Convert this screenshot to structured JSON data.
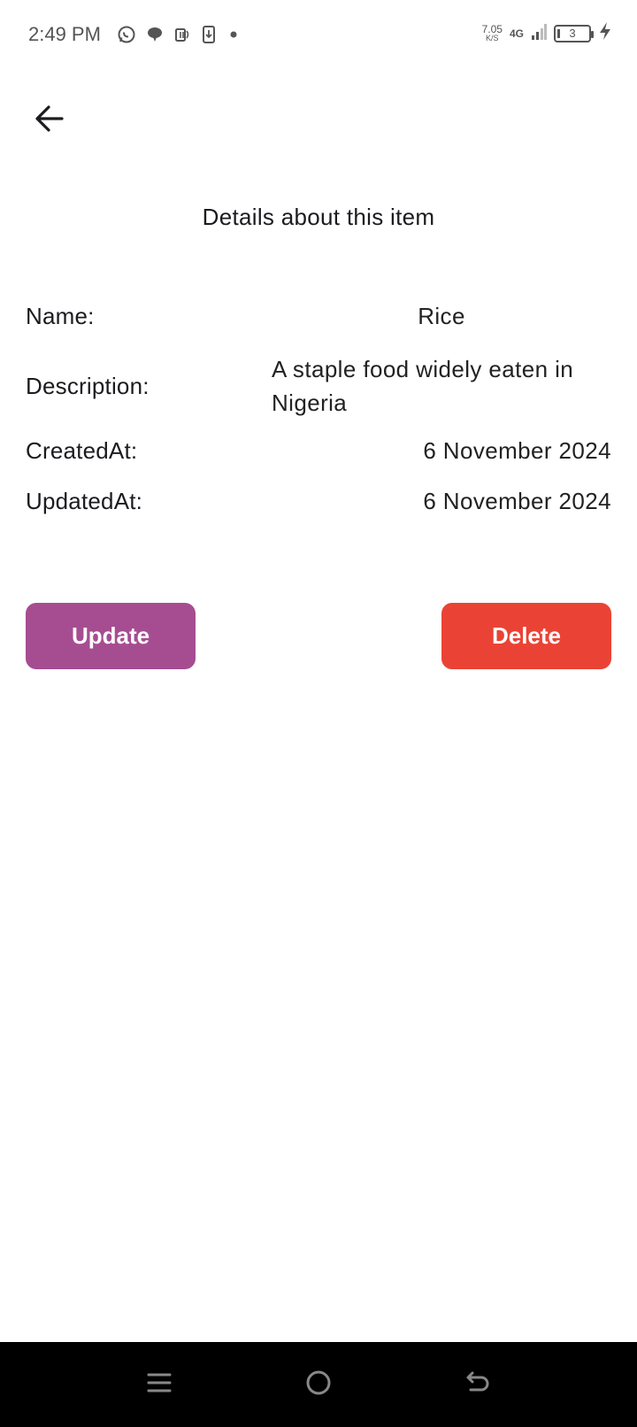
{
  "status_bar": {
    "time": "2:49 PM",
    "net_speed_value": "7.05",
    "net_speed_unit": "K/S",
    "network_type": "4G",
    "battery_level": "3",
    "notification_icons": [
      "whatsapp-icon",
      "chat-icon",
      "nfc-icon",
      "download-icon",
      "dot-icon"
    ]
  },
  "header": {
    "back_icon": "arrow-left-icon",
    "title": "Details about this item"
  },
  "details": {
    "name_label": "Name:",
    "name_value": "Rice",
    "description_label": "Description:",
    "description_value": "A staple food widely eaten in Nigeria",
    "created_label": "CreatedAt:",
    "created_value": "6 November 2024",
    "updated_label": "UpdatedAt:",
    "updated_value": "6 November 2024"
  },
  "actions": {
    "update_label": "Update",
    "update_color": "#a64d91",
    "delete_label": "Delete",
    "delete_color": "#ea4335"
  },
  "nav_bar": {
    "icons": [
      "menu-icon",
      "home-circle-icon",
      "back-arrow-icon"
    ]
  }
}
